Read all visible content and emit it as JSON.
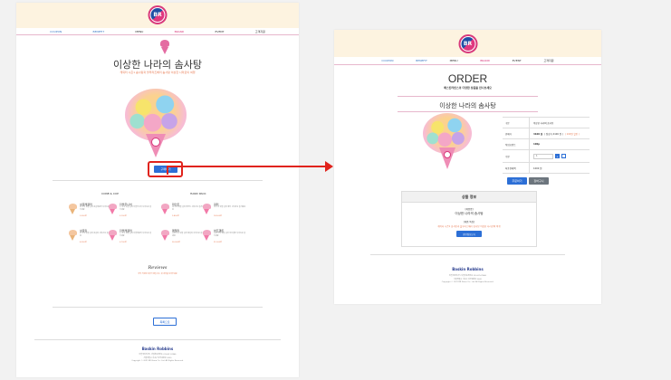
{
  "nav": {
    "items": [
      "COUPON",
      "BENEFIT",
      "MENU",
      "BRAND",
      "EVENT",
      "고객지원"
    ]
  },
  "logo_text": "BR",
  "left": {
    "title": "이상한 나라의 솜사탕",
    "subtitle": "캐릭터 시즌1 솜사탕과 블루라즈베리 솜사탕 이상한 나라로의 여행",
    "order_button": "구매하기",
    "cone_cup_label": "CONE & CUP",
    "hand_pack_label": "HAND PACK",
    "products_left": [
      {
        "name": "싱글레귤러",
        "desc": "한 가지 맛을 골라 싱글레귤러 사이즈로 즐기세요",
        "price": "3,500원"
      },
      {
        "name": "더블주니어",
        "desc": "두 가지 맛을 골라 더블주니어 사이즈로 즐기세요",
        "price": "5,100원"
      },
      {
        "name": "싱글킹",
        "desc": "한 가지 맛을 골라 싱글킹 사이즈로 즐기세요",
        "price": "4,300원"
      },
      {
        "name": "더블레귤러",
        "desc": "두 가지 맛을 골라 더블레귤러 사이즈로 즐기세요",
        "price": "6,700원"
      }
    ],
    "products_right": [
      {
        "name": "파인트",
        "desc": "세 가지 맛을 골라 파인트 사이즈로 즐기세요",
        "price": "9,800원"
      },
      {
        "name": "쿼터",
        "desc": "네 가지 맛을 골라 쿼터 사이즈로 즐기세요",
        "price": "18,500원"
      },
      {
        "name": "패밀리",
        "desc": "다섯 가지 맛을 골라 패밀리 사이즈로 즐기세요",
        "price": "26,000원"
      },
      {
        "name": "하프갤론",
        "desc": "여섯 가지 맛을 골라 하프갤론 사이즈로 즐기세요",
        "price": "31,500원"
      }
    ],
    "reviews_title": "Reviews",
    "reviews_sub": "아직 작성된 리뷰가 없습니다. 첫 리뷰를 남겨주세요",
    "list_button": "목록으로"
  },
  "footer": {
    "logo": "Baskin Robbins",
    "line1": "비알코리아(주) 사업자등록번호 220-87-07466",
    "line2": "서울특별시 서초구 남부순환로 2620",
    "line3": "Copyright © 2021 BR Korea Co., Ltd. All Rights Reserved."
  },
  "right": {
    "order_title": "ORDER",
    "order_sub": "배스킨라빈스의 다양한 상품을 만나보세요",
    "product_title": "이상한 나라의 솜사탕",
    "table": {
      "name_label": "구분",
      "name_value": "이상한 나라의 솜사탕",
      "price_label": "판매가",
      "price_value": "4100 원",
      "price_extra": "( 정상가 4100 원 )",
      "price_discount": "( 100원 할인 )",
      "delivery_label": "적립포인트",
      "delivery_value": "100p",
      "qty_label": "수량",
      "qty_value": "1",
      "total_label": "최종결제액",
      "total_value": "1000 원"
    },
    "buy_button": "주문하기",
    "cart_button": "장바구니",
    "info_title": "상품 정보",
    "info_name_label": "[제품명]",
    "info_name": "이상한 나라의 솜사탕",
    "info_desc_label": "[제품 특징]",
    "info_desc": "캐릭터 시즌1 솜사탕과 블루라즈베리 솜사탕 이상한 나라로의 여행",
    "nutri_button": "영양정보보기"
  },
  "colors": {
    "accent_pink": "#d8387b",
    "accent_blue": "#2c6fd6",
    "header_bg": "#fdf3e0",
    "highlight_red": "#e0231c"
  }
}
